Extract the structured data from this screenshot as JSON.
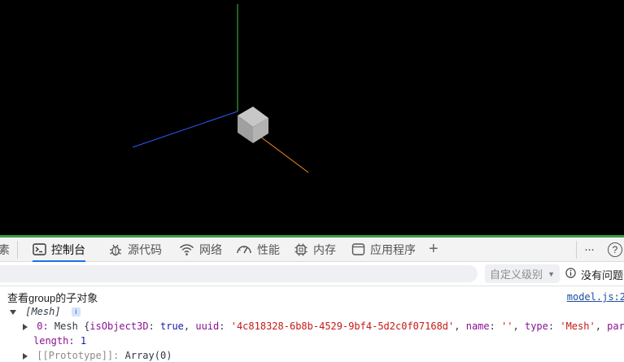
{
  "tabs": [
    {
      "label": "素",
      "icon": "elements-icon",
      "active": false
    },
    {
      "label": "控制台",
      "icon": "console-icon",
      "active": true
    },
    {
      "label": "源代码",
      "icon": "bug-icon",
      "active": false
    },
    {
      "label": "网络",
      "icon": "wifi-icon",
      "active": false
    },
    {
      "label": "性能",
      "icon": "gauge-icon",
      "active": false
    },
    {
      "label": "内存",
      "icon": "chip-icon",
      "active": false
    },
    {
      "label": "应用程序",
      "icon": "app-window-icon",
      "active": false
    }
  ],
  "tab_add_symbol": "+",
  "more_symbol": "···",
  "help_symbol": "?",
  "filter": {
    "placeholder": "",
    "value": ""
  },
  "level_select": {
    "label": "自定义级别",
    "arrow": "▼"
  },
  "issues": {
    "label": "没有问题"
  },
  "console": {
    "log_message": "查看group的子对象",
    "source": "model.js:2",
    "array_label": "[Mesh]",
    "array_info_badge": "i",
    "item0": {
      "index": "0:",
      "type": "Mesh",
      "open_brace": "{",
      "isObject3D_key": "isObject3D",
      "isObject3D_val": "true",
      "uuid_key": "uuid",
      "uuid_val": "'4c818328-6b8b-4529-9bf4-5d2c0f07168d'",
      "name_key": "name",
      "name_val": "''",
      "type_key": "type",
      "type_val": "'Mesh'",
      "tail": "par"
    },
    "length_key": "length:",
    "length_val": "1",
    "prototype_key": "[[Prototype]]:",
    "prototype_val": "Array(0)"
  },
  "colors": {
    "accent_line": "#3c9a4a",
    "active_tab_underline": "#1a73e8",
    "axis_x": "#ff7f00",
    "axis_y": "#00ff00",
    "axis_z": "#0055ff"
  }
}
